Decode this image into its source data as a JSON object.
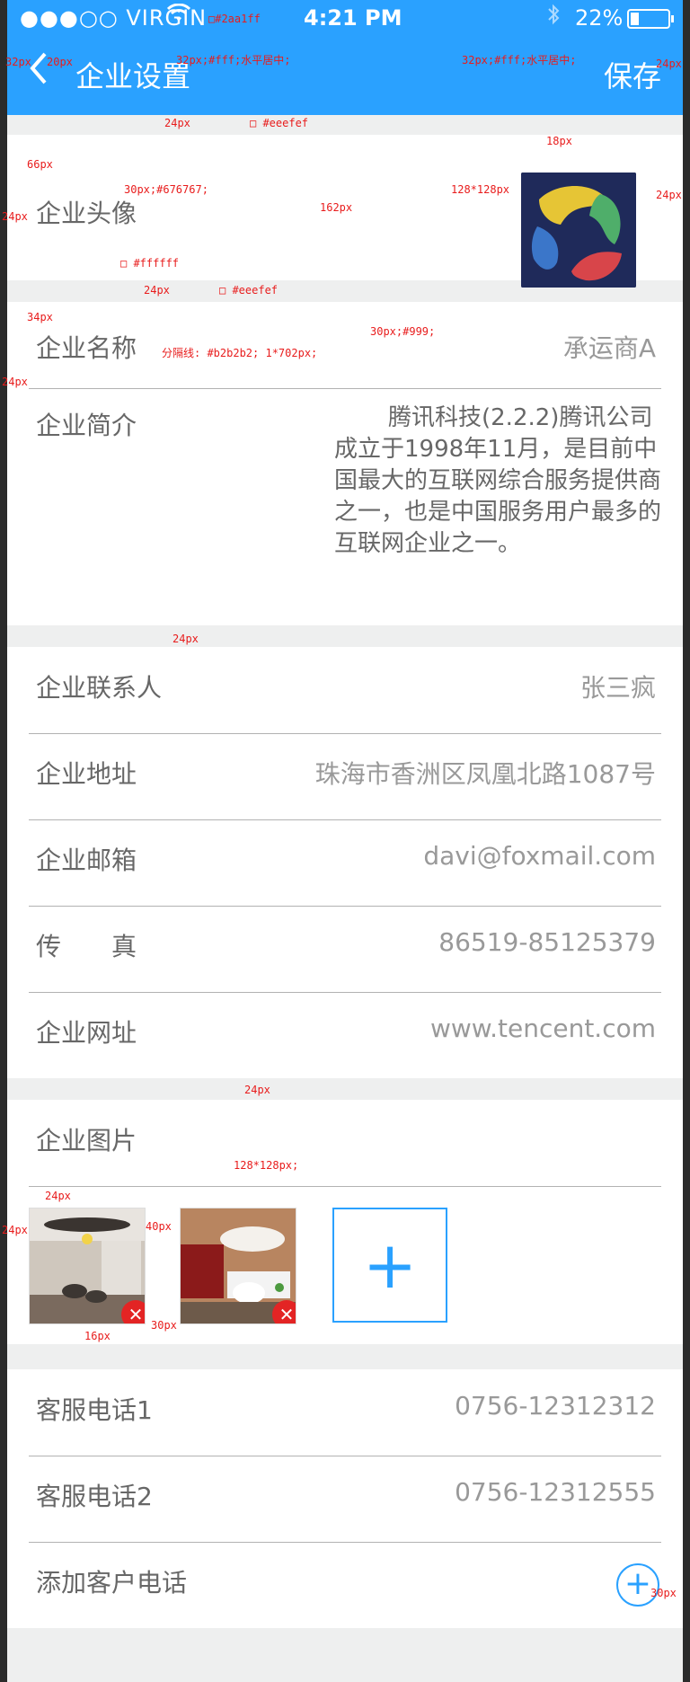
{
  "status_bar": {
    "carrier": "●●●○○ VIRGIN",
    "time": "4:21 PM",
    "battery": "22%"
  },
  "nav": {
    "back_label": "<",
    "title": "企业设置",
    "save_label": "保存"
  },
  "annotations": {
    "a1": "32px",
    "a2": "20px",
    "a3": "32px;#fff;水平居中;",
    "a4": "32px;#fff;水平居中;",
    "a5": "24px",
    "a6": "24px",
    "a7": "□ #eeefef",
    "a8": "66px",
    "a9": "30px;#676767;",
    "a10": "162px",
    "a11": "128*128px",
    "a12": "18px",
    "a13": "24px",
    "a14": "24px",
    "a15": "□ #ffffff",
    "a16": "24px",
    "a17": "□ #eeefef",
    "a18": "34px",
    "a19": "分隔线: #b2b2b2; 1*702px;",
    "a20": "30px;#999;",
    "a21": "24px",
    "a22": "24px",
    "a23": "24px",
    "a24": "128*128px;",
    "a25": "24px",
    "a26": "24px",
    "a27": "40px",
    "a28": "16px",
    "a29": "30px",
    "a30": "30px",
    "a31": "□#2aa1ff"
  },
  "profile": {
    "avatar_label": "企业头像",
    "name_label": "企业名称",
    "name_value": "承运商A",
    "intro_label": "企业简介",
    "intro_value": "腾讯科技(2.2.2)腾讯公司成立于1998年11月，是目前中国最大的互联网综合服务提供商之一，也是中国服务用户最多的互联网企业之一。"
  },
  "contact": {
    "rows": [
      {
        "label": "企业联系人",
        "value": "张三疯"
      },
      {
        "label": "企业地址",
        "value": "珠海市香洲区凤凰北路1087号"
      },
      {
        "label": "企业邮箱",
        "value": "davi@foxmail.com"
      },
      {
        "label": "传　　真",
        "value": "86519-85125379"
      },
      {
        "label": "企业网址",
        "value": "www.tencent.com"
      }
    ]
  },
  "pictures": {
    "label": "企业图片",
    "add_symbol": "+",
    "delete_symbol": "✕"
  },
  "phones": {
    "rows": [
      {
        "label": "客服电话1",
        "value": "0756-12312312"
      },
      {
        "label": "客服电话2",
        "value": "0756-12312555"
      }
    ],
    "add_label": "添加客户电话",
    "add_symbol": "+"
  },
  "colors": {
    "brand": "#2aa1ff",
    "bg": "#eeefef",
    "divider": "#b2b2b2",
    "label": "#676767",
    "value": "#999999",
    "delete": "#e32424"
  }
}
